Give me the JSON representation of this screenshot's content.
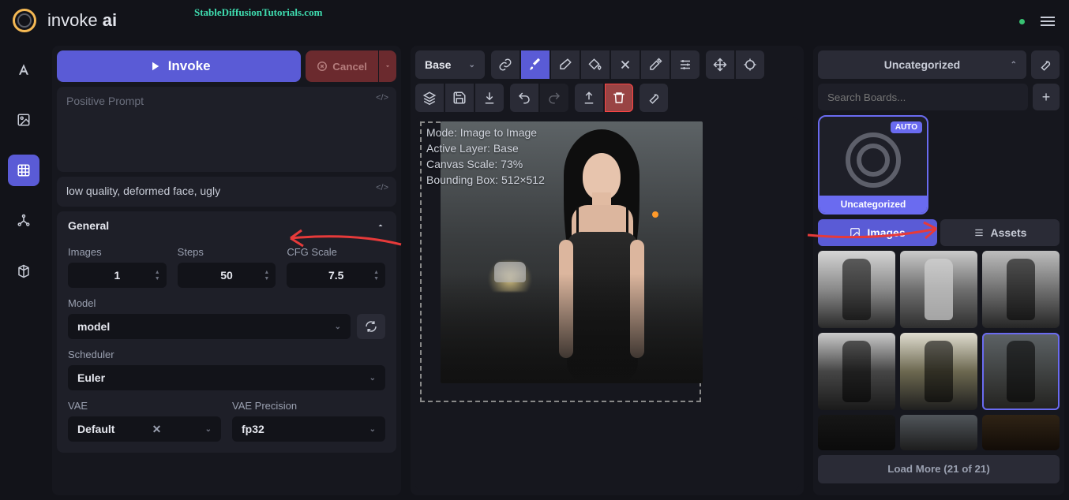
{
  "header": {
    "brand_prefix": "invoke ",
    "brand_bold": "ai",
    "tutorials": "StableDiffusionTutorials.com"
  },
  "invoke": {
    "label": "Invoke",
    "cancel": "Cancel"
  },
  "prompts": {
    "positive_placeholder": "Positive Prompt",
    "negative_value": "low quality, deformed face, ugly"
  },
  "general": {
    "title": "General",
    "images_label": "Images",
    "images_value": "1",
    "steps_label": "Steps",
    "steps_value": "50",
    "cfg_label": "CFG Scale",
    "cfg_value": "7.5",
    "model_label": "Model",
    "model_value": "model",
    "scheduler_label": "Scheduler",
    "scheduler_value": "Euler",
    "vae_label": "VAE",
    "vae_value": "Default",
    "vae_precision_label": "VAE Precision",
    "vae_precision_value": "fp32"
  },
  "canvas": {
    "base_label": "Base",
    "meta_mode": "Mode: Image to Image",
    "meta_layer": "Active Layer: Base",
    "meta_scale": "Canvas Scale: 73%",
    "meta_bbox": "Bounding Box: 512×512"
  },
  "boards": {
    "selected": "Uncategorized",
    "search_placeholder": "Search Boards...",
    "auto_badge": "AUTO",
    "card_name": "Uncategorized"
  },
  "tabs": {
    "images": "Images",
    "assets": "Assets"
  },
  "load_more": "Load More (21 of 21)"
}
